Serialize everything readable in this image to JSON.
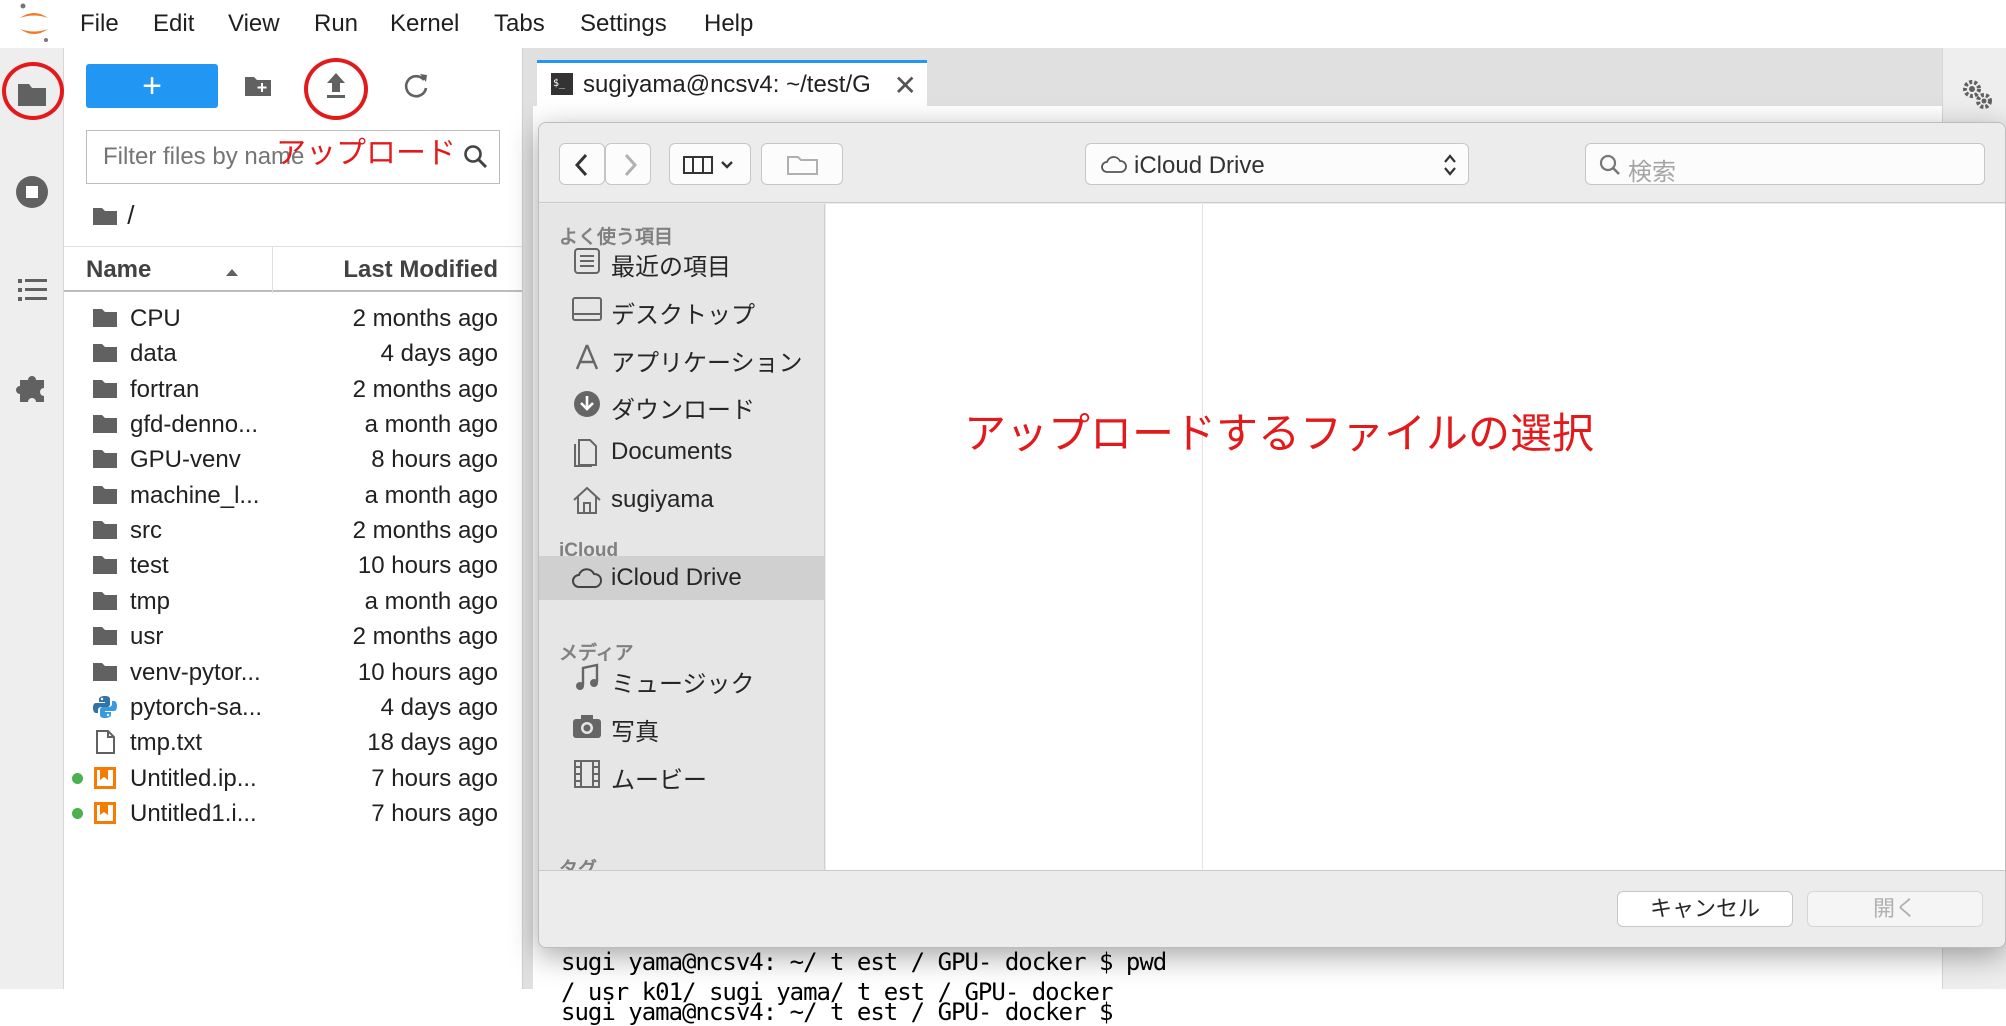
{
  "menu": {
    "items": [
      "File",
      "Edit",
      "View",
      "Run",
      "Kernel",
      "Tabs",
      "Settings",
      "Help"
    ]
  },
  "filebrowser": {
    "new_launcher_label": "+",
    "filter_placeholder": "Filter files by name",
    "breadcrumb": "/",
    "columns": {
      "name": "Name",
      "modified": "Last Modified"
    },
    "files": [
      {
        "name": "CPU",
        "modified": "2 months ago",
        "type": "folder",
        "running": false
      },
      {
        "name": "data",
        "modified": "4 days ago",
        "type": "folder",
        "running": false
      },
      {
        "name": "fortran",
        "modified": "2 months ago",
        "type": "folder",
        "running": false
      },
      {
        "name": "gfd-denno...",
        "modified": "a month ago",
        "type": "folder",
        "running": false
      },
      {
        "name": "GPU-venv",
        "modified": "8 hours ago",
        "type": "folder",
        "running": false
      },
      {
        "name": "machine_l...",
        "modified": "a month ago",
        "type": "folder",
        "running": false
      },
      {
        "name": "src",
        "modified": "2 months ago",
        "type": "folder",
        "running": false
      },
      {
        "name": "test",
        "modified": "10 hours ago",
        "type": "folder",
        "running": false
      },
      {
        "name": "tmp",
        "modified": "a month ago",
        "type": "folder",
        "running": false
      },
      {
        "name": "usr",
        "modified": "2 months ago",
        "type": "folder",
        "running": false
      },
      {
        "name": "venv-pytor...",
        "modified": "10 hours ago",
        "type": "folder",
        "running": false
      },
      {
        "name": "pytorch-sa...",
        "modified": "4 days ago",
        "type": "python",
        "running": false
      },
      {
        "name": "tmp.txt",
        "modified": "18 days ago",
        "type": "text",
        "running": false
      },
      {
        "name": "Untitled.ip...",
        "modified": "7 hours ago",
        "type": "notebook",
        "running": true
      },
      {
        "name": "Untitled1.i...",
        "modified": "7 hours ago",
        "type": "notebook",
        "running": true
      }
    ]
  },
  "tab": {
    "label": "sugiyama@ncsv4: ~/test/G",
    "close": "✕",
    "icon_text": "$_"
  },
  "terminal": {
    "lines": [
      "sugi yama@ncsv4: ~/ t est / GPU- docker $",
      "sugi yama@ncsv4: ~/ t est / GPU- docker $  pwd",
      "/ usr k01/ sugi yama/ t est / GPU- docker"
    ]
  },
  "dialog": {
    "location": "iCloud Drive",
    "search_placeholder": "検索",
    "sections": [
      {
        "heading": "よく使う項目",
        "items": [
          {
            "label": "最近の項目",
            "icon": "recents-icon"
          },
          {
            "label": "デスクトップ",
            "icon": "desktop-icon"
          },
          {
            "label": "アプリケーション",
            "icon": "applications-icon"
          },
          {
            "label": "ダウンロード",
            "icon": "downloads-icon"
          },
          {
            "label": "Documents",
            "icon": "documents-icon"
          },
          {
            "label": "sugiyama",
            "icon": "home-icon"
          }
        ]
      },
      {
        "heading": "iCloud",
        "items": [
          {
            "label": "iCloud Drive",
            "icon": "cloud-icon",
            "selected": true
          }
        ]
      },
      {
        "heading": "メディア",
        "items": [
          {
            "label": "ミュージック",
            "icon": "music-icon"
          },
          {
            "label": "写真",
            "icon": "camera-icon"
          },
          {
            "label": "ムービー",
            "icon": "film-icon"
          }
        ]
      },
      {
        "heading": "タグ",
        "items": []
      }
    ],
    "cancel_label": "キャンセル",
    "open_label": "開く"
  },
  "annotations": {
    "upload_text": "アップロード",
    "select_text": "アップロードするファイルの選択",
    "color": "#e31a1c"
  },
  "colors": {
    "accent": "#2196f3",
    "running_dot": "#4caf50"
  }
}
